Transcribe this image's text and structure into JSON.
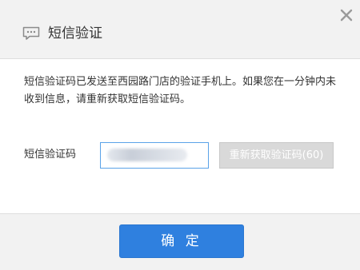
{
  "dialog": {
    "title": "短信验证",
    "title_icon": "sms-chat-icon",
    "close_icon": "close-icon"
  },
  "body": {
    "message": "短信验证码已发送至西园路门店的验证手机上。如果您在一分钟内未收到信息，请重新获取短信验证码。",
    "code_label": "短信验证码",
    "resend_label": "重新获取验证码(60)"
  },
  "footer": {
    "confirm_label": "确 定"
  },
  "colors": {
    "primary": "#2f80df",
    "input_border": "#5aa2e8",
    "disabled_button": "#d9d9d9"
  }
}
